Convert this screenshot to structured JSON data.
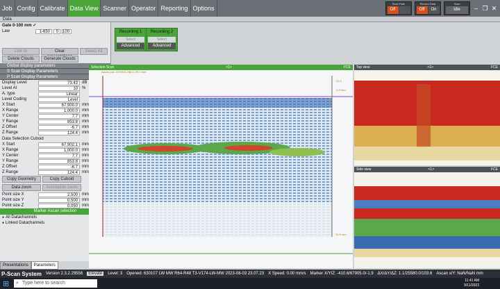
{
  "menu": {
    "tabs": [
      "Job",
      "Config",
      "Calibrate",
      "Data View",
      "Scanner",
      "Operator",
      "Reporting",
      "Options"
    ],
    "active": "Data View"
  },
  "topright": {
    "scan_path_label": "Scan Path",
    "scan_path_off": "Off",
    "scan_path_on": "",
    "record_data_label": "Record Data",
    "record_data_off": "Off",
    "record_data_on": "On",
    "scan_label": "Scan",
    "scan_value": "Idle"
  },
  "data_header": "Data",
  "gate": {
    "title": "Gate 0-100 mm ✓",
    "law_label": "Law",
    "law_value": "1-650",
    "law_a": "0",
    "law_b": "100"
  },
  "recording": [
    {
      "title": "Recording 1",
      "select": "Select",
      "advanced": "Advanced"
    },
    {
      "title": "Recording 2",
      "select": "Select",
      "advanced": "Advanced"
    }
  ],
  "buttons": {
    "link": "Link to presentations",
    "clear": "Clear presentations",
    "select_all": "Select All",
    "delete_clouds": "Delete Clouds",
    "generate_clouds": "Generate Clouds",
    "copy_geometry": "Copy Geometry",
    "copy_cuboid": "Copy Cuboid",
    "data_zoom": "Data zoom",
    "annotation_zoom": "Annotation zoom",
    "marker_ascan": "Marker Ascan selection"
  },
  "sections": [
    "Global display parameters",
    "S Scan Display Parameters",
    "P Scan Display Parameters"
  ],
  "pscan": [
    {
      "k": "Display Level",
      "v": "73.43",
      "u": "dB"
    },
    {
      "k": "Level At",
      "v": "10",
      "u": "%"
    },
    {
      "k": "A. type",
      "v": "Linear",
      "u": ""
    },
    {
      "k": "Level Coding",
      "v": "Level",
      "u": ""
    },
    {
      "k": "X Start",
      "v": "67,900.0",
      "u": "mm"
    },
    {
      "k": "X Range",
      "v": "1,000.0",
      "u": "mm"
    },
    {
      "k": "Y Center",
      "v": "7.7",
      "u": "mm"
    },
    {
      "k": "Y Range",
      "v": "853.8",
      "u": "mm"
    },
    {
      "k": "Z Offset",
      "v": "-6.7",
      "u": "mm"
    },
    {
      "k": "Z Range",
      "v": "124.4",
      "u": "mm"
    }
  ],
  "cuboid_title": "Data Selection Cuboid",
  "cuboid": [
    {
      "k": "X Start",
      "v": "67,902.1",
      "u": "mm"
    },
    {
      "k": "X Range",
      "v": "1,000.0",
      "u": "mm"
    },
    {
      "k": "Y Center",
      "v": "7.7",
      "u": "mm"
    },
    {
      "k": "Y Range",
      "v": "853.8",
      "u": "mm"
    },
    {
      "k": "Z Offset",
      "v": "-6.7",
      "u": "mm"
    },
    {
      "k": "Z Range",
      "v": "124.4",
      "u": "mm"
    }
  ],
  "points": [
    {
      "k": "Point size X",
      "v": "2.500",
      "u": "mm"
    },
    {
      "k": "Point size Y",
      "v": "0.500",
      "u": "mm"
    },
    {
      "k": "Point size Z",
      "v": "0.050",
      "u": "mm"
    }
  ],
  "channels": [
    "All Datachannels",
    "Linked Datachannels"
  ],
  "bottom_tabs": [
    "Presentations",
    "Parameters"
  ],
  "views": {
    "selection": {
      "title": "Selection Scan",
      "center": "<1>",
      "right": "FCE",
      "info": "Ascan pos: 67900.0,288.0,-99.1 mm",
      "readout_top": "-19.2",
      "readout_mid": "-1.9 mm",
      "readout_bot": "21.9 mm"
    },
    "top": {
      "title": "Top view",
      "center": "<1>",
      "right": "FCE"
    },
    "side": {
      "title": "Side view",
      "center": "<1>",
      "right": "FCE"
    }
  },
  "status": {
    "app": "P-Scan System",
    "version": "Version 2.3.2.29556",
    "elevate": "Elevate",
    "level": "Level: 3",
    "opened": "Opened: 630107 LW MW R64-R48 T3-V174-LW-MW 2023-08-03 23.07.23",
    "xspeed": "X Speed: 0.00 mm/s",
    "marker": "Marker X/Y/Z: -410.6/67905.0/-1.9",
    "delta": "ΔX/ΔY/ΔZ: 1.1/25580.0/103.6",
    "ascan": "Ascan x/Y: NaN/NaN mm"
  },
  "taskbar": {
    "search": "Type here to search",
    "time": "11:41 AM",
    "date": "9/11/2023"
  },
  "colors": {
    "accent": "#4aa43a",
    "toggle_on": "#d7501e"
  }
}
